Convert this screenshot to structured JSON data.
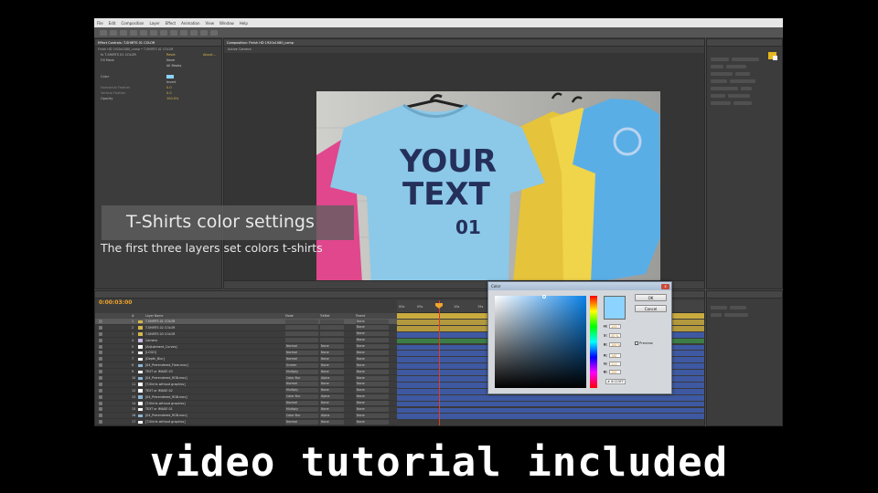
{
  "menu": [
    "File",
    "Edit",
    "Composition",
    "Layer",
    "Effect",
    "Animation",
    "View",
    "Window",
    "Help"
  ],
  "effects": {
    "tab_title": "Effect Controls: T-SHIRTS 01 COLOR",
    "breadcrumb": "Finish HD 1920x1080_comp • T-SHIRTS 01 COLOR",
    "rows": [
      {
        "label": "fx T-SHIRTS 01 COLOR",
        "value": "Reset",
        "value2": "About..."
      },
      {
        "label": "Fill Mask",
        "value": "None",
        "value2": ""
      },
      {
        "label": "",
        "value": "All Masks",
        "value2": ""
      },
      {
        "label": "",
        "value": "",
        "value2": ""
      },
      {
        "label": "Color",
        "value": "",
        "value2": ""
      },
      {
        "label": "",
        "value": "Invert",
        "value2": ""
      },
      {
        "label": "Horizontal Feather",
        "value": "0.0",
        "value2": ""
      },
      {
        "label": "Vertical Feather",
        "value": "0.0",
        "value2": ""
      },
      {
        "label": "Opacity",
        "value": "100.0%",
        "value2": ""
      }
    ]
  },
  "viewer": {
    "tab_title": "Composition: Finish HD 1920x1080_comp",
    "sub_tab": "Active Camera"
  },
  "timeline": {
    "timecode": "0:00:03:00",
    "header": {
      "num": "#",
      "name": "Layer Name",
      "mode": "Mode",
      "matte": "TrkMat",
      "parent": "Parent"
    },
    "layers": [
      {
        "num": "1",
        "name": "T-SHIRTS 01 COLOR",
        "mode": "",
        "matte": "",
        "parent": "None",
        "chip": "#d4b64a",
        "selected": true
      },
      {
        "num": "2",
        "name": "T-SHIRTS 02 COLOR",
        "mode": "",
        "matte": "",
        "parent": "None",
        "chip": "#d4b64a"
      },
      {
        "num": "3",
        "name": "T-SHIRTS 03 COLOR",
        "mode": "",
        "matte": "",
        "parent": "None",
        "chip": "#d4b64a"
      },
      {
        "num": "4",
        "name": "Camera",
        "mode": "",
        "matte": "",
        "parent": "None",
        "chip": "#c9b7e6"
      },
      {
        "num": "5",
        "name": "[Adjustment_Curves]",
        "mode": "Normal",
        "matte": "None",
        "parent": "None",
        "chip": "#ffffff"
      },
      {
        "num": "6",
        "name": "[LOGO]",
        "mode": "Normal",
        "matte": "None",
        "parent": "None",
        "chip": "#ffffff"
      },
      {
        "num": "7",
        "name": "[Depth_Blur]",
        "mode": "Normal",
        "matte": "None",
        "parent": "None",
        "chip": "#ffffff"
      },
      {
        "num": "8",
        "name": "[04_Prerendered_Flare.mov]",
        "mode": "Screen",
        "matte": "None",
        "parent": "None",
        "chip": "#8ab6d6"
      },
      {
        "num": "9",
        "name": "TEXT or IMAGE 03",
        "mode": "Multiply",
        "matte": "None",
        "parent": "None",
        "chip": "#ffffff"
      },
      {
        "num": "10",
        "name": "[04_Prerendered_RGB.mov]",
        "mode": "Color Bur",
        "matte": "Alpha",
        "parent": "None",
        "chip": "#8ab6d6"
      },
      {
        "num": "11",
        "name": "[T-Shirts without graphics]",
        "mode": "Normal",
        "matte": "None",
        "parent": "None",
        "chip": "#ffffff"
      },
      {
        "num": "12",
        "name": "TEXT or IMAGE 02",
        "mode": "Multiply",
        "matte": "None",
        "parent": "None",
        "chip": "#ffffff"
      },
      {
        "num": "13",
        "name": "[04_Prerendered_RGB.mov]",
        "mode": "Color Bur",
        "matte": "Alpha",
        "parent": "None",
        "chip": "#8ab6d6"
      },
      {
        "num": "14",
        "name": "[T-Shirts without graphics]",
        "mode": "Normal",
        "matte": "None",
        "parent": "None",
        "chip": "#ffffff"
      },
      {
        "num": "15",
        "name": "TEXT or IMAGE 01",
        "mode": "Multiply",
        "matte": "None",
        "parent": "None",
        "chip": "#ffffff"
      },
      {
        "num": "16",
        "name": "[04_Prerendered_RGB.mov]",
        "mode": "Color Bur",
        "matte": "Alpha",
        "parent": "None",
        "chip": "#8ab6d6"
      },
      {
        "num": "17",
        "name": "[T-Shirts without graphics]",
        "mode": "Normal",
        "matte": "None",
        "parent": "None",
        "chip": "#ffffff"
      }
    ],
    "ruler_labels": [
      "00s",
      "05s",
      "10s",
      "15s"
    ]
  },
  "shirt_text": {
    "line1": "YOUR",
    "line2": "TEXT",
    "line3": "01"
  },
  "caption": {
    "title": "T-Shirts color settings",
    "subtitle": "The first three layers set colors t-shirts"
  },
  "color_dialog": {
    "title": "Color",
    "close_label": "x",
    "ok_label": "OK",
    "cancel_label": "Cancel",
    "fields": [
      {
        "label": "H:",
        "value": "203 °"
      },
      {
        "label": "S:",
        "value": "45 %"
      },
      {
        "label": "B:",
        "value": "100 %"
      },
      {
        "label": "R:",
        "value": "140"
      },
      {
        "label": "G:",
        "value": "211"
      },
      {
        "label": "B:",
        "value": "255"
      }
    ],
    "preview_label": "Preview",
    "hex": "# 8CD3FF",
    "selected_color": "#8CD3FF"
  },
  "colors": {
    "accent": "#f2a52b",
    "layer_bar_gold": "#c9aa3f",
    "layer_bar_blue": "#3f5fb5",
    "layer_bar_green": "#3d8a4a"
  },
  "tagline": "video tutorial included"
}
